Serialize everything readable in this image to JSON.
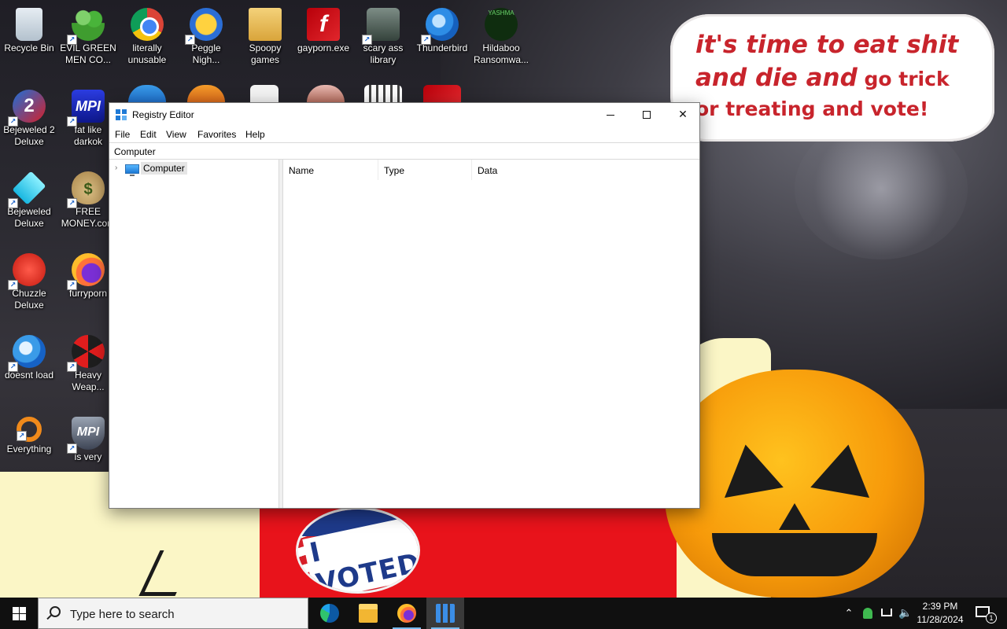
{
  "wallpaper": {
    "speech_line1": "it's time to eat shit",
    "speech_line2_big": "and die and",
    "speech_line2_small": " go trick",
    "speech_line3": "or treating and vote!",
    "voted_text": "I VOTED",
    "speech_color": "#c8242c"
  },
  "desktop_icons": [
    {
      "label": "Recycle Bin",
      "icon": "recycle-bin-icon"
    },
    {
      "label": "EVIL GREEN MEN CO...",
      "icon": "people-icon"
    },
    {
      "label": "literally unusable",
      "icon": "chrome-icon"
    },
    {
      "label": "Peggle Nigh...",
      "icon": "peggle-icon"
    },
    {
      "label": "Spoopy games",
      "icon": "folder-icon"
    },
    {
      "label": "gayporn.exe",
      "icon": "flash-icon"
    },
    {
      "label": "scary ass library",
      "icon": "library-icon"
    },
    {
      "label": "Thunderbird",
      "icon": "thunderbird-icon"
    },
    {
      "label": "Hildaboo Ransomwa...",
      "icon": "yashma-icon",
      "badge": "YASHMA"
    },
    {
      "label": "Bejeweled 2 Deluxe",
      "icon": "bejeweled2-icon",
      "glyph": "2"
    },
    {
      "label": "fat like darkok",
      "icon": "mpi-icon",
      "glyph": "MPI"
    },
    {
      "label": "Bejeweled Deluxe",
      "icon": "diamond-icon"
    },
    {
      "label": "FREE MONEY.com",
      "icon": "money-bag-icon",
      "glyph": "$"
    },
    {
      "label": "Chuzzle Deluxe",
      "icon": "chuzzle-icon"
    },
    {
      "label": "furryporn",
      "icon": "firefox-icon"
    },
    {
      "label": "doesnt load",
      "icon": "thunderbird-icon"
    },
    {
      "label": "Heavy Weap...",
      "icon": "radiation-icon"
    },
    {
      "label": "Everything",
      "icon": "everything-search-icon"
    },
    {
      "label": "is very",
      "icon": "mpi-shield-icon",
      "glyph": "MPI"
    }
  ],
  "window": {
    "title": "Registry Editor",
    "close_glyph": "✕",
    "menu": [
      "File",
      "Edit",
      "View",
      "Favorites",
      "Help"
    ],
    "address": "Computer",
    "tree": {
      "root_label": "Computer",
      "chevron": "›"
    },
    "columns": [
      "Name",
      "Type",
      "Data"
    ]
  },
  "taskbar": {
    "search_placeholder": "Type here to search",
    "apps": [
      "edge-icon",
      "file-explorer-icon",
      "firefox-icon",
      "registry-editor-icon"
    ],
    "tray_chevron": "⌃",
    "volume_glyph": "🔈",
    "time": "2:39 PM",
    "date": "11/28/2024",
    "notification_count": "1",
    "accent": "#76b9ed"
  }
}
